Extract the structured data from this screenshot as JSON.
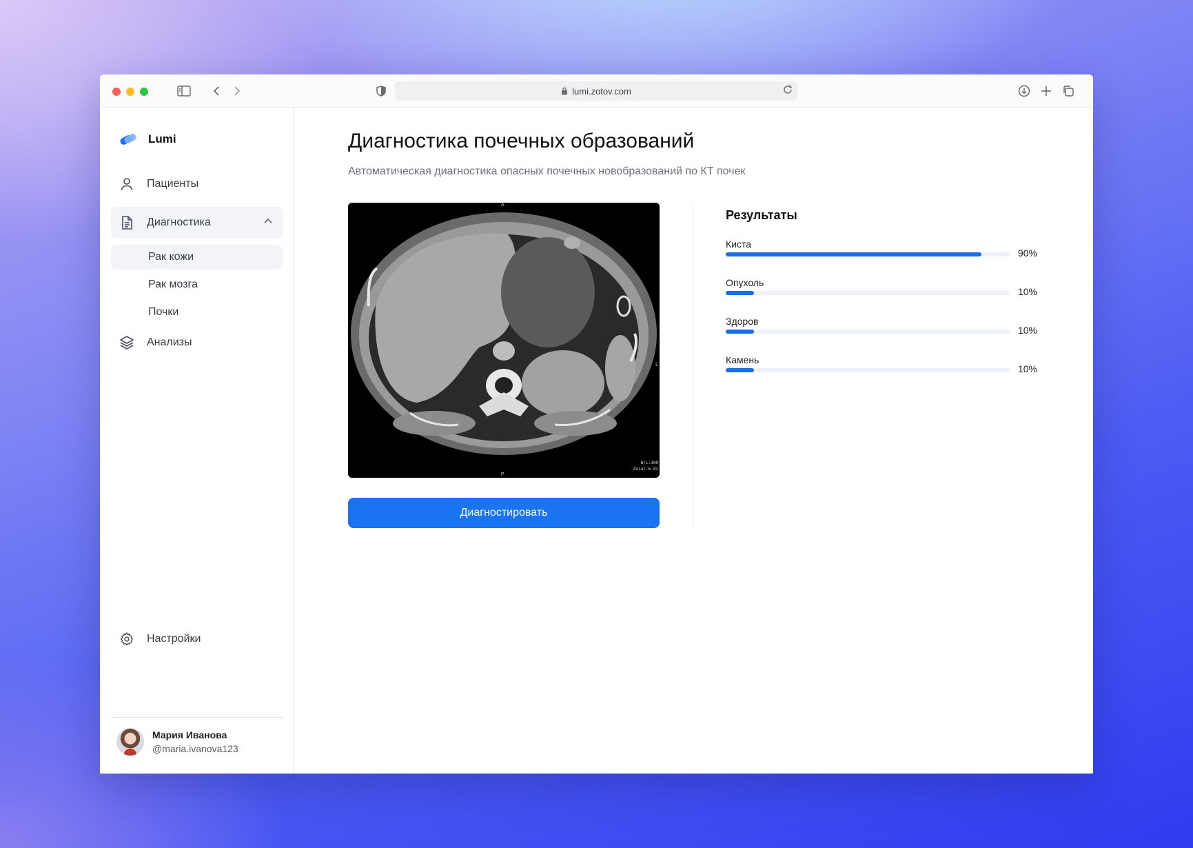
{
  "browser": {
    "url": "lumi.zotov.com"
  },
  "sidebar": {
    "brand": "Lumi",
    "nav": {
      "patients": "Пациенты",
      "diagnostics": "Диагностика",
      "analyses": "Анализы",
      "settings": "Настройки"
    },
    "sub_items": [
      "Рак кожи",
      "Рак мозга",
      "Почки"
    ],
    "user": {
      "name": "Мария Иванова",
      "handle": "@maria.ivanova123"
    }
  },
  "main": {
    "title": "Диагностика почечных образований",
    "subtitle": "Автоматическая диагностика опасных почечных новобразований по КТ почек",
    "scan_labels": {
      "top": "A",
      "bottom": "P",
      "side": "L",
      "window": "W/L:300",
      "series": "Axial 6.82"
    },
    "diagnose_button": "Диагностировать",
    "results_title": "Результаты",
    "results": [
      {
        "label": "Киста",
        "value": 90,
        "pct": "90%"
      },
      {
        "label": "Опухоль",
        "value": 10,
        "pct": "10%"
      },
      {
        "label": "Здоров",
        "value": 10,
        "pct": "10%"
      },
      {
        "label": "Камень",
        "value": 10,
        "pct": "10%"
      }
    ]
  },
  "colors": {
    "accent": "#1a73f0",
    "progress": "#1a6fe6",
    "track": "#eef2f8"
  }
}
